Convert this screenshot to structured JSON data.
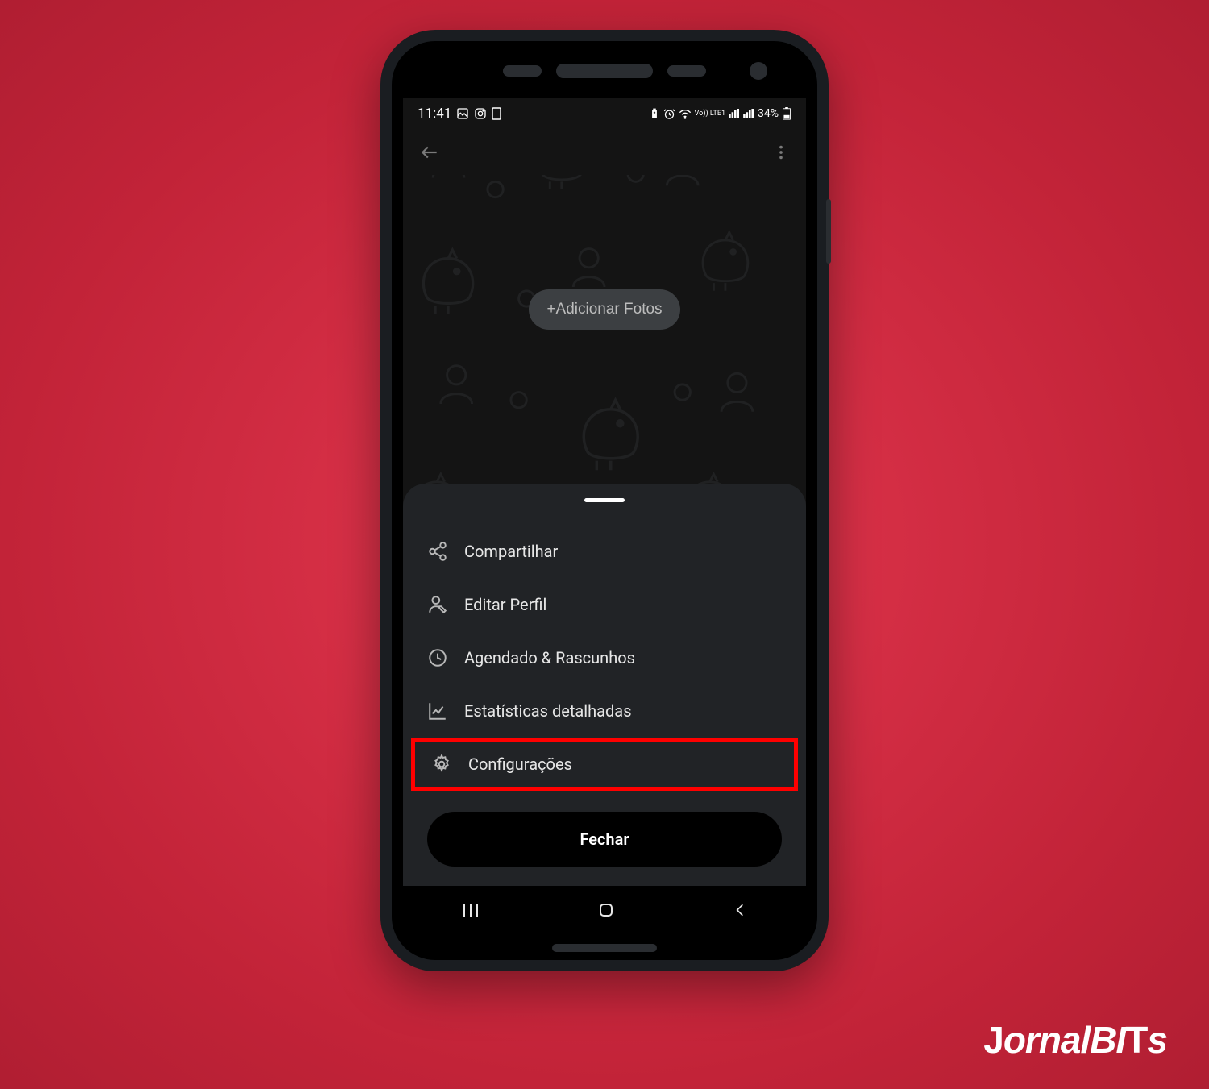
{
  "status": {
    "time": "11:41",
    "battery_text": "34%",
    "network_label": "Vo)) LTE1"
  },
  "hero": {
    "add_photos_label": "+Adicionar Fotos"
  },
  "sheet": {
    "items": [
      {
        "icon": "share-icon",
        "label": "Compartilhar"
      },
      {
        "icon": "edit-profile-icon",
        "label": "Editar Perfil"
      },
      {
        "icon": "clock-icon",
        "label": "Agendado & Rascunhos"
      },
      {
        "icon": "chart-icon",
        "label": "Estatísticas detalhadas"
      },
      {
        "icon": "gear-icon",
        "label": "Configurações"
      }
    ],
    "highlighted_index": 4,
    "close_label": "Fechar"
  },
  "watermark": {
    "text": "JornalBITs"
  },
  "colors": {
    "background_accent": "#d52c42",
    "phone_shell": "#1a1d21",
    "sheet_bg": "#212326",
    "highlight_border": "#ff0000"
  }
}
